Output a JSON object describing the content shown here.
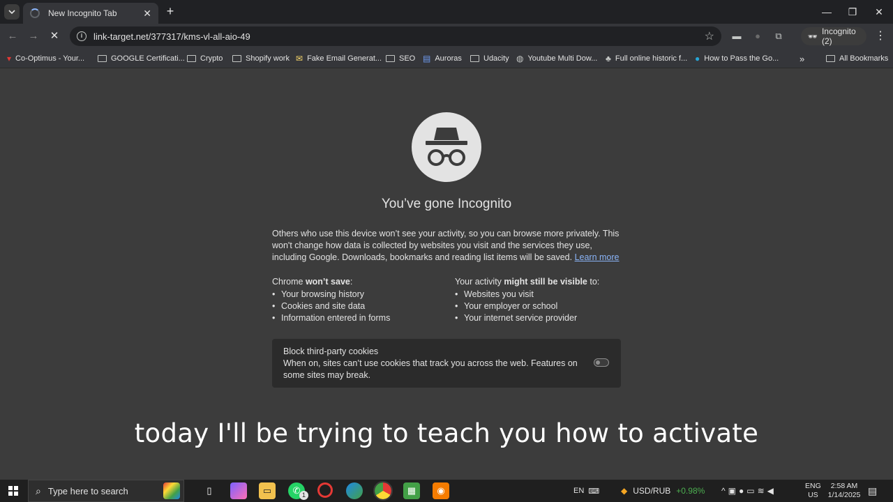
{
  "browser": {
    "tab": {
      "title": "New Incognito Tab",
      "close": "✕"
    },
    "new_tab": "+",
    "window_controls": {
      "minimize": "—",
      "restore": "❐",
      "close": "✕"
    },
    "url": "link-target.net/377317/kms-vl-all-aio-49",
    "profile_chip": "Incognito (2)",
    "bookmarks": [
      {
        "label": "Co-Optimus - Your...",
        "icon": "site-favicon"
      },
      {
        "label": "GOOGLE Certificati...",
        "icon": "folder-icon"
      },
      {
        "label": "Crypto",
        "icon": "folder-icon"
      },
      {
        "label": "Shopify work",
        "icon": "folder-icon"
      },
      {
        "label": "Fake Email Generat...",
        "icon": "site-favicon"
      },
      {
        "label": "SEO",
        "icon": "folder-icon"
      },
      {
        "label": "Auroras",
        "icon": "doc-favicon"
      },
      {
        "label": "Udacity",
        "icon": "folder-icon"
      },
      {
        "label": "Youtube Multi Dow...",
        "icon": "globe-icon"
      },
      {
        "label": "Full online historic f...",
        "icon": "site-favicon"
      },
      {
        "label": "How to Pass the Go...",
        "icon": "site-favicon"
      }
    ],
    "bookmarks_overflow": "»",
    "all_bookmarks": "All Bookmarks"
  },
  "page": {
    "title": "You’ve gone Incognito",
    "description": "Others who use this device won’t see your activity, so you can browse more privately. This won't change how data is collected by websites you visit and the services they use, including Google. Downloads, bookmarks and reading list items will be saved.",
    "learn_more": "Learn more",
    "wont_save": {
      "prefix": "Chrome ",
      "bold": "won’t save",
      "suffix": ":",
      "items": [
        "Your browsing history",
        "Cookies and site data",
        "Information entered in forms"
      ]
    },
    "visible": {
      "prefix": "Your activity ",
      "bold": "might still be visible",
      "suffix": " to:",
      "items": [
        "Websites you visit",
        "Your employer or school",
        "Your internet service provider"
      ]
    },
    "cookies": {
      "title": "Block third-party cookies",
      "description": "When on, sites can’t use cookies that track you across the web. Features on some sites may break.",
      "enabled": false
    }
  },
  "caption": "today I'll be trying to teach you how to activate",
  "taskbar": {
    "search_placeholder": "Type here to search",
    "whatsapp_badge": "1",
    "language": "EN",
    "ticker": {
      "label": "USD/RUB",
      "change": "+0.98%"
    },
    "ime": {
      "lang": "ENG",
      "region": "US"
    },
    "clock": {
      "time": "2:58 AM",
      "date": "1/14/2025"
    }
  },
  "colors": {
    "accent_link": "#8ab4f8",
    "ticker_positive": "#4caf50",
    "page_bg": "#3c3c3c"
  }
}
